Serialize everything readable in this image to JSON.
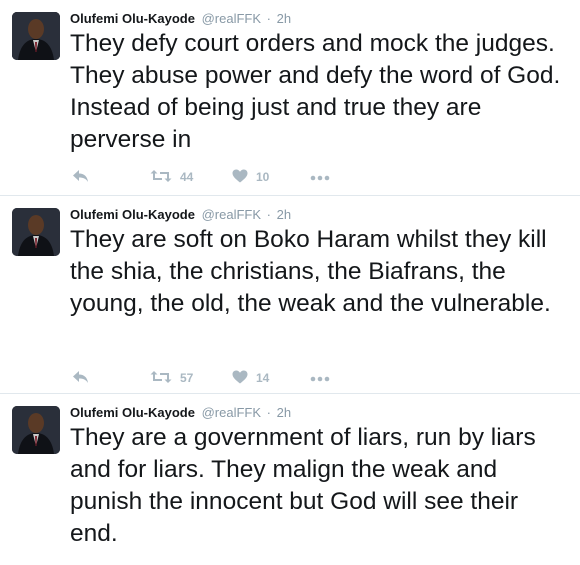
{
  "colors": {
    "name": "#14171a",
    "meta": "#8899a6",
    "icon": "#aab8c2",
    "divider": "#e1e8ed"
  },
  "tweets": [
    {
      "name": "Olufemi Olu-Kayode",
      "handle": "@realFFK",
      "separator": "·",
      "time": "2h",
      "text": "They defy court orders and mock the judges. They abuse power and defy the word of God. Instead of being just and true they are perverse in",
      "retweets": "44",
      "likes": "10"
    },
    {
      "name": "Olufemi Olu-Kayode",
      "handle": "@realFFK",
      "separator": "·",
      "time": "2h",
      "text": "They are soft on Boko Haram whilst they kill the shia, the christians, the Biafrans, the young, the old, the weak and the vulnerable.",
      "retweets": "57",
      "likes": "14"
    },
    {
      "name": "Olufemi Olu-Kayode",
      "handle": "@realFFK",
      "separator": "·",
      "time": "2h",
      "text": "They are a government of liars, run by liars and for liars. They malign the weak and punish the innocent but God will see their end."
    }
  ],
  "icons": {
    "reply": "reply-icon",
    "retweet": "retweet-icon",
    "like": "heart-icon",
    "more": "more-icon"
  }
}
